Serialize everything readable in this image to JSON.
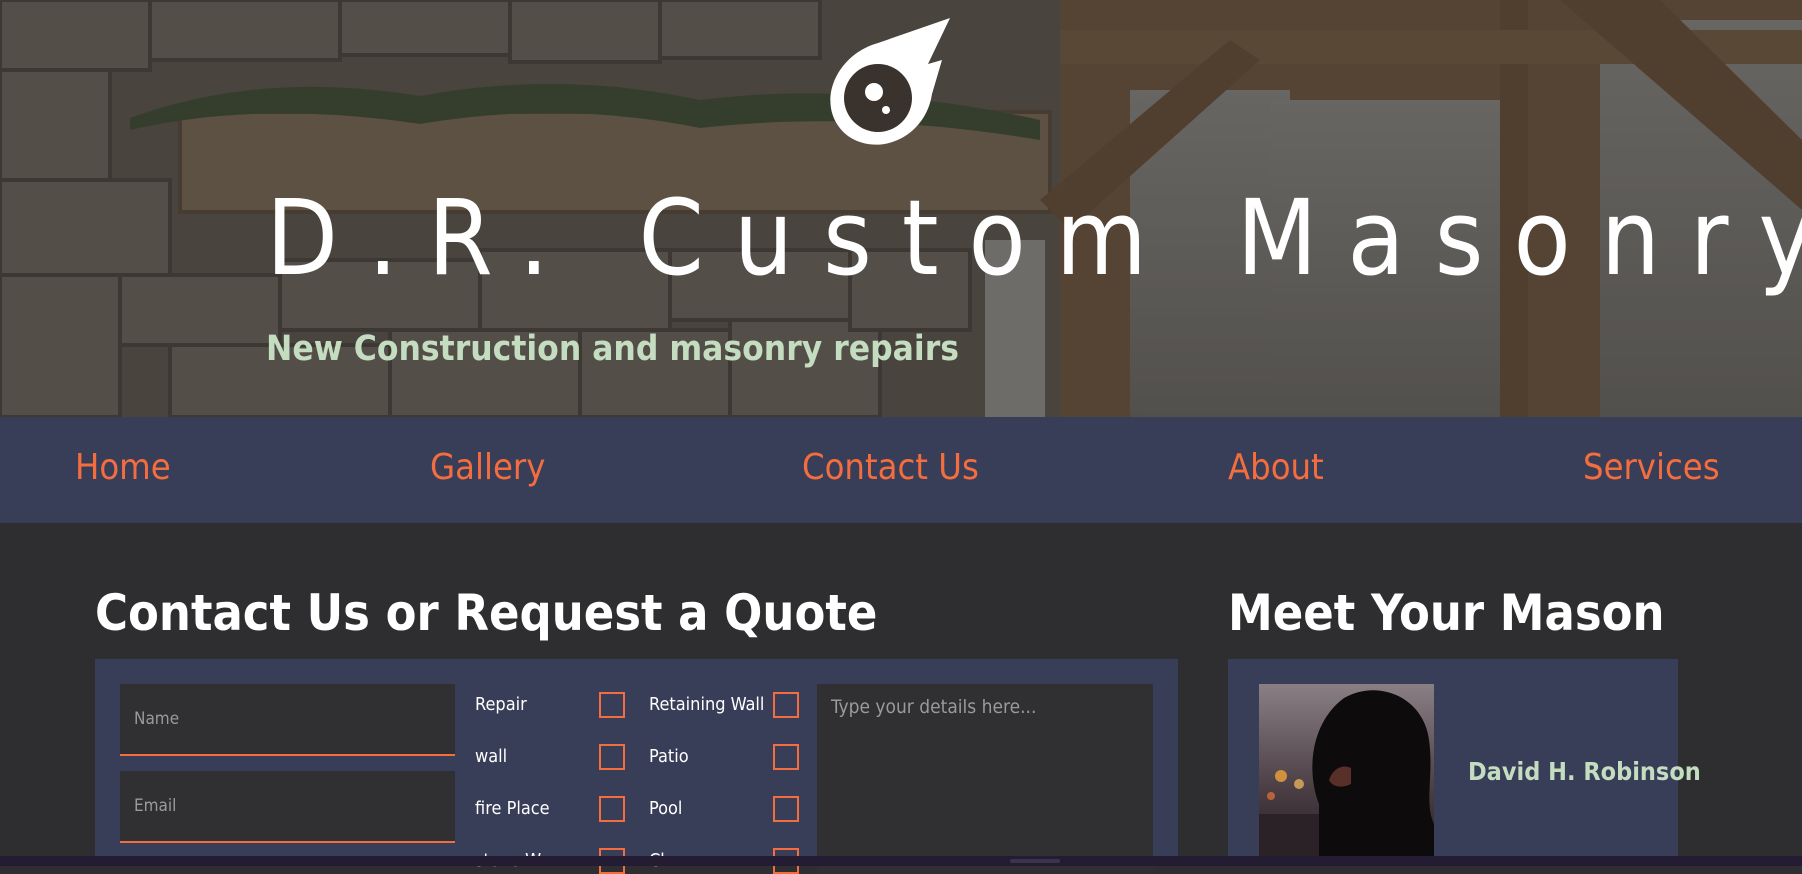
{
  "hero": {
    "title": "D.R. Custom Masonry",
    "tagline": "New Construction and masonry repairs",
    "logo_icon": "flame-drop-logo-icon",
    "background_icon": "stone-fireplace-photo"
  },
  "nav": {
    "items": [
      {
        "label": "Home"
      },
      {
        "label": "Gallery"
      },
      {
        "label": "Contact Us"
      },
      {
        "label": "About"
      },
      {
        "label": "Services"
      }
    ]
  },
  "contact": {
    "heading": "Contact Us or Request a Quote",
    "name_placeholder": "Name",
    "email_placeholder": "Email",
    "details_placeholder": "Type your details here...",
    "services": [
      {
        "label": "Repair"
      },
      {
        "label": "Retaining Wall"
      },
      {
        "label": "wall"
      },
      {
        "label": "Patio"
      },
      {
        "label": "fire Place"
      },
      {
        "label": "Pool"
      },
      {
        "label": "stone W"
      },
      {
        "label": "Ch"
      }
    ]
  },
  "mason": {
    "heading": "Meet Your Mason",
    "name": "David H. Robinson",
    "photo_icon": "hooded-mason-portrait"
  },
  "colors": {
    "accent": "#f36d3e",
    "nav_bg": "#383d58",
    "page_bg": "#2e2e30",
    "tagline": "#c4dcc0",
    "input_bg": "#303032"
  }
}
